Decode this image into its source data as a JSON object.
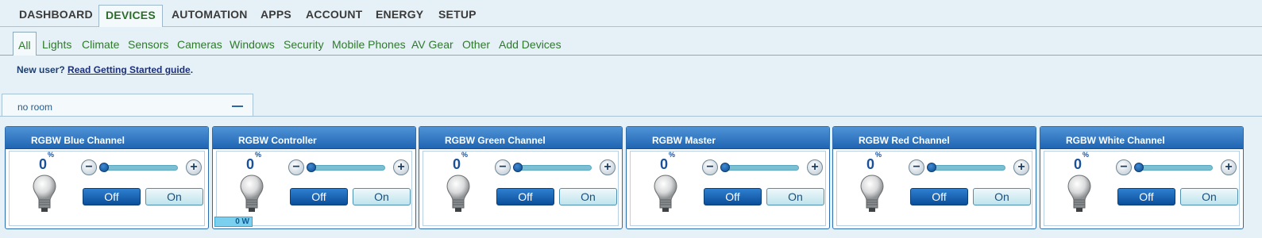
{
  "top_nav": {
    "tabs": [
      {
        "label": "DASHBOARD",
        "active": false
      },
      {
        "label": "DEVICES",
        "active": true
      },
      {
        "label": "AUTOMATION",
        "active": false
      },
      {
        "label": "APPS",
        "active": false
      },
      {
        "label": "ACCOUNT",
        "active": false
      },
      {
        "label": "ENERGY",
        "active": false
      },
      {
        "label": "SETUP",
        "active": false
      }
    ]
  },
  "sub_nav": {
    "tabs": [
      {
        "label": "All",
        "active": true
      },
      {
        "label": "Lights"
      },
      {
        "label": "Climate"
      },
      {
        "label": "Sensors"
      },
      {
        "label": "Cameras"
      },
      {
        "label": "Windows"
      },
      {
        "label": "Security"
      },
      {
        "label": "Mobile Phones"
      },
      {
        "label": "AV Gear"
      },
      {
        "label": "Other"
      },
      {
        "label": "Add Devices"
      }
    ]
  },
  "notice": {
    "prefix": "New user? ",
    "link": "Read Getting Started guide",
    "suffix": "."
  },
  "room": {
    "title": "no room",
    "collapse_icon": "minus-icon"
  },
  "devices": [
    {
      "name": "RGBW Blue Channel",
      "level": "0",
      "level_unit": "%",
      "off_label": "Off",
      "on_label": "On",
      "power": null
    },
    {
      "name": "RGBW Controller",
      "level": "0",
      "level_unit": "%",
      "off_label": "Off",
      "on_label": "On",
      "power": "0 W"
    },
    {
      "name": "RGBW Green Channel",
      "level": "0",
      "level_unit": "%",
      "off_label": "Off",
      "on_label": "On",
      "power": null
    },
    {
      "name": "RGBW Master",
      "level": "0",
      "level_unit": "%",
      "off_label": "Off",
      "on_label": "On",
      "power": null
    },
    {
      "name": "RGBW Red Channel",
      "level": "0",
      "level_unit": "%",
      "off_label": "Off",
      "on_label": "On",
      "power": null
    },
    {
      "name": "RGBW White Channel",
      "level": "0",
      "level_unit": "%",
      "off_label": "Off",
      "on_label": "On",
      "power": null
    }
  ],
  "controls": {
    "minus": "−",
    "plus": "+"
  },
  "icons": {
    "bulb": "lightbulb-icon",
    "minus": "minus-icon",
    "plus": "plus-icon"
  },
  "colors": {
    "accent_blue": "#1f65b3",
    "active_green": "#2e7a2b",
    "background": "#e6f0f7"
  }
}
